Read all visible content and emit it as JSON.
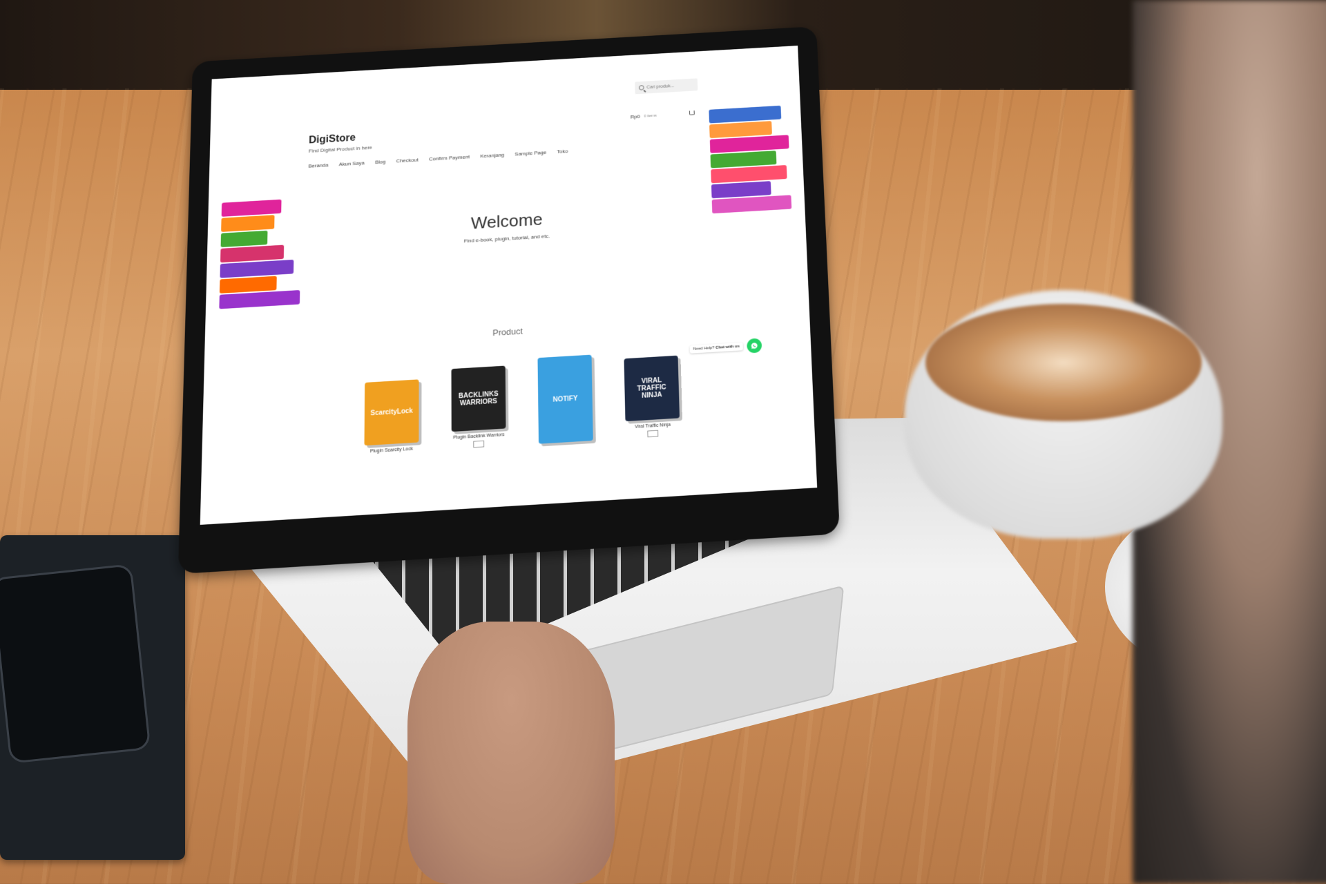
{
  "site": {
    "brand": "DigiStore",
    "tagline": "Find Digital Product in here"
  },
  "search": {
    "placeholder": "Cari produk..."
  },
  "nav": {
    "items": [
      {
        "label": "Beranda"
      },
      {
        "label": "Akun Saya"
      },
      {
        "label": "Blog"
      },
      {
        "label": "Checkout"
      },
      {
        "label": "Confirm Payment"
      },
      {
        "label": "Keranjang"
      },
      {
        "label": "Sample Page"
      },
      {
        "label": "Toko"
      }
    ]
  },
  "cart": {
    "total": "Rp0",
    "count": "0 items"
  },
  "hero": {
    "title": "Welcome",
    "subtitle": "Find e-book, plugin, tutorial, and etc."
  },
  "chat": {
    "prefix": "Need Help?",
    "label": "Chat with us"
  },
  "products": {
    "heading": "Product",
    "items": [
      {
        "box_text": "ScarcityLock",
        "name": "Plugin Scarcity Lock",
        "button": "",
        "color": "#f0a020"
      },
      {
        "box_text": "BACKLINKS WARRIORS",
        "name": "Plugin Backlink Warriors",
        "button": "",
        "color": "#222222"
      },
      {
        "box_text": "NOTIFY",
        "name": "",
        "button": "",
        "color": "#3aa0e0"
      },
      {
        "box_text": "VIRAL TRAFFIC NINJA",
        "name": "Viral Traffic Ninja",
        "button": "",
        "color": "#1d2a44"
      }
    ]
  },
  "colors": {
    "whatsapp": "#25d366"
  }
}
